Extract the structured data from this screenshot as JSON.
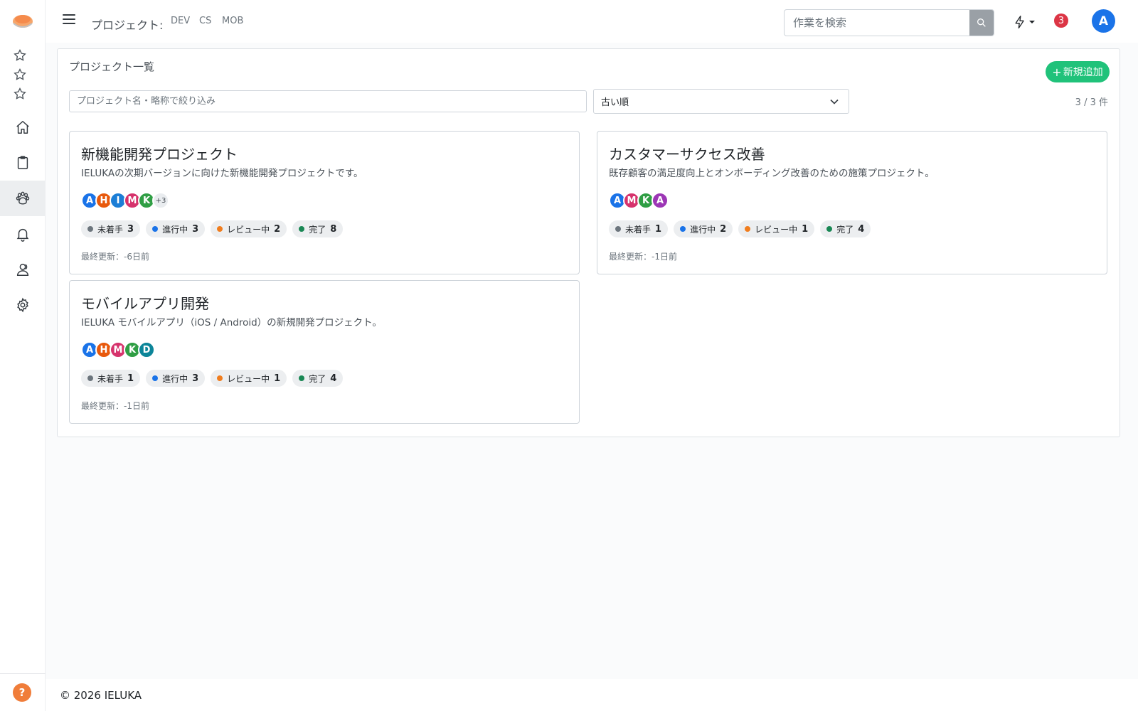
{
  "header": {
    "project_label": "プロジェクト:",
    "project_links": [
      "DEV",
      "CS",
      "MOB"
    ],
    "search_placeholder": "作業を検索",
    "notification_count": "3",
    "user_initial": "A"
  },
  "sidebar": {
    "icons": [
      "star-icon",
      "star-icon",
      "star-icon",
      "home-icon",
      "clipboard-icon",
      "paw-icon",
      "bell-icon",
      "users-icon",
      "gear-icon"
    ],
    "active_item": "paw-icon",
    "help_label": "?"
  },
  "panel": {
    "title": "プロジェクト一覧",
    "add_button": "新規追加",
    "filter_placeholder": "プロジェクト名・略称で絞り込み",
    "sort_value": "古い順",
    "count": "3 / 3 件"
  },
  "status_labels": {
    "todo": "未着手",
    "doing": "進行中",
    "review": "レビュー中",
    "done": "完了"
  },
  "colors": {
    "todo": "#6c757d",
    "doing": "#1a73e8",
    "review": "#f07d1e",
    "done": "#198754",
    "accent": "#20c27a"
  },
  "projects": [
    {
      "name": "新機能開発プロジェクト",
      "description": "IELUKAの次期バージョンに向けた新機能開発プロジェクトです。",
      "members": [
        {
          "initial": "A",
          "color": "#1a73e8"
        },
        {
          "initial": "H",
          "color": "#e8590c"
        },
        {
          "initial": "I",
          "color": "#1c7ed6"
        },
        {
          "initial": "M",
          "color": "#d6336c"
        },
        {
          "initial": "K",
          "color": "#2f9e44"
        }
      ],
      "more_members": "+3",
      "counts": {
        "todo": "3",
        "doing": "3",
        "review": "2",
        "done": "8"
      },
      "updated": "最終更新：-6日前"
    },
    {
      "name": "カスタマーサクセス改善",
      "description": "既存顧客の満足度向上とオンボーディング改善のための施策プロジェクト。",
      "members": [
        {
          "initial": "A",
          "color": "#1a73e8"
        },
        {
          "initial": "M",
          "color": "#d6336c"
        },
        {
          "initial": "K",
          "color": "#2f9e44"
        },
        {
          "initial": "A",
          "color": "#9c36b5"
        }
      ],
      "more_members": "",
      "counts": {
        "todo": "1",
        "doing": "2",
        "review": "1",
        "done": "4"
      },
      "updated": "最終更新：-1日前"
    },
    {
      "name": "モバイルアプリ開発",
      "description": "IELUKA モバイルアプリ（iOS / Android）の新規開発プロジェクト。",
      "members": [
        {
          "initial": "A",
          "color": "#1a73e8"
        },
        {
          "initial": "H",
          "color": "#e8590c"
        },
        {
          "initial": "M",
          "color": "#d6336c"
        },
        {
          "initial": "K",
          "color": "#2f9e44"
        },
        {
          "initial": "D",
          "color": "#0c8599"
        }
      ],
      "more_members": "",
      "counts": {
        "todo": "1",
        "doing": "3",
        "review": "1",
        "done": "4"
      },
      "updated": "最終更新：-1日前"
    }
  ],
  "footer": {
    "text": "© 2026 IELUKA"
  }
}
